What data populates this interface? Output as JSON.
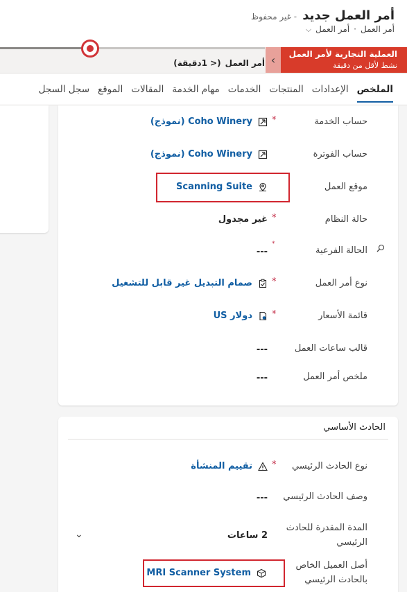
{
  "header": {
    "title": "أمر العمل جديد",
    "unsaved": "- غير محفوظ",
    "entity": "أمر العمل",
    "form_selector": "أمر العمل"
  },
  "bpf": {
    "stage_name": "أمر العمل",
    "stage_duration": "(< 1دقيقة)",
    "flyout_title": "العملية التجارية لأمر العمل",
    "flyout_subtitle": "نشط لأقل من دقيقة"
  },
  "tabs": [
    {
      "label": "الملخص",
      "active": true
    },
    {
      "label": "الإعدادات"
    },
    {
      "label": "المنتجات"
    },
    {
      "label": "الخدمات"
    },
    {
      "label": "مهام الخدمة"
    },
    {
      "label": "المقالات"
    },
    {
      "label": "الموقع"
    },
    {
      "label": "سجل السجل"
    }
  ],
  "summary": {
    "service_account": {
      "label": "حساب الخدمة",
      "value": "Coho Winery (نموذج)",
      "required": "*"
    },
    "billing_account": {
      "label": "حساب الفوترة",
      "value": "Coho Winery (نموذج)"
    },
    "work_location": {
      "label": "موقع العمل",
      "value": "Scanning Suite"
    },
    "system_status": {
      "label": "حالة النظام",
      "value": "غير مجدول",
      "required": "*"
    },
    "substatus": {
      "label": "الحالة الفرعية",
      "value": "---",
      "required": "*"
    },
    "work_order_type": {
      "label": "نوع أمر العمل",
      "value": "صمام التبديل غير قابل للتشغيل",
      "required": "*"
    },
    "price_list": {
      "label": "قائمة الأسعار",
      "value": "دولار US",
      "required": "*"
    },
    "time_template": {
      "label": "قالب ساعات العمل",
      "value": "---"
    },
    "summary_field": {
      "label": "ملخص أمر العمل",
      "value": "---"
    }
  },
  "primary_incident": {
    "section_title": "الحادث الأساسي",
    "incident_type": {
      "label": "نوع الحادث الرئيسي",
      "value": "تقييم المنشأة",
      "required": "*"
    },
    "incident_description": {
      "label": "وصف الحادث الرئيسي",
      "value": "---"
    },
    "estimated_duration": {
      "label": "المدة المقدرة للحادث الرئيسي",
      "value": "2 ساعات"
    },
    "customer_asset": {
      "label": "أصل العميل الخاص بالحادث الرئيسي",
      "value": "MRI Scanner System"
    }
  },
  "colors": {
    "accent": "#115ea3",
    "bpf_active": "#d83b2a",
    "highlight": "#d1262f",
    "required": "#c4314b"
  },
  "icons": {
    "account": "account-icon",
    "location": "location-pin-icon",
    "search": "search-icon",
    "clipboard": "clipboard-icon",
    "price": "price-list-icon",
    "warning": "warning-triangle-icon",
    "asset": "asset-box-icon"
  }
}
